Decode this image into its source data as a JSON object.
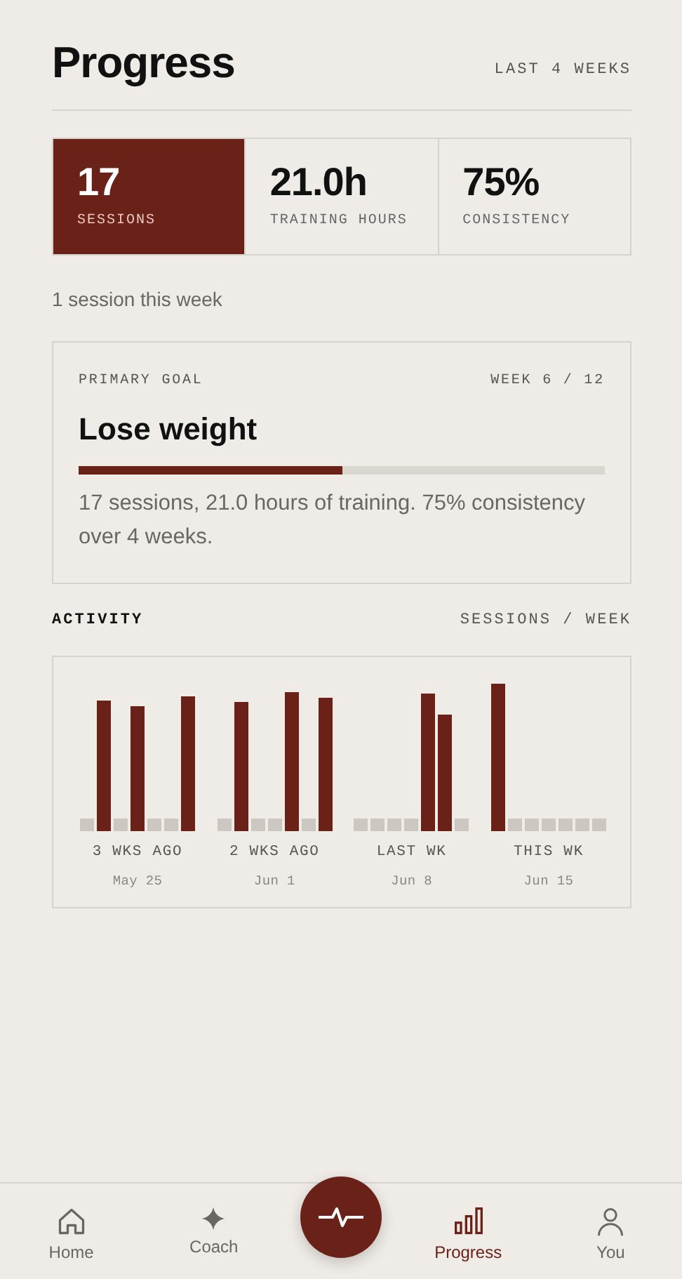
{
  "header": {
    "title": "Progress",
    "range": "LAST 4 WEEKS"
  },
  "stats": [
    {
      "value": "17",
      "label": "SESSIONS",
      "selected": true
    },
    {
      "value": "21.0h",
      "label": "TRAINING HOURS",
      "selected": false
    },
    {
      "value": "75%",
      "label": "CONSISTENCY",
      "selected": false
    }
  ],
  "week_note": "1 session this week",
  "goal": {
    "label": "PRIMARY GOAL",
    "week": "WEEK 6 / 12",
    "title": "Lose weight",
    "level": 0.5,
    "summary": "17 sessions, 21.0 hours of training. 75% consistency over 4 weeks."
  },
  "activity": {
    "title": "ACTIVITY",
    "unit": "SESSIONS / WEEK",
    "weeks": [
      {
        "label": "3 WKS AGO",
        "date": "May 25",
        "days": [
          {
            "trained": false
          },
          {
            "trained": true
          },
          {
            "trained": false
          },
          {
            "trained": true
          },
          {
            "trained": false
          },
          {
            "trained": false
          },
          {
            "trained": true
          }
        ]
      },
      {
        "label": "2 WKS AGO",
        "date": "Jun 1",
        "days": [
          {
            "trained": false
          },
          {
            "trained": true
          },
          {
            "trained": false
          },
          {
            "trained": false
          },
          {
            "trained": true
          },
          {
            "trained": false
          },
          {
            "trained": true
          }
        ]
      },
      {
        "label": "LAST WK",
        "date": "Jun 8",
        "days": [
          {
            "trained": false
          },
          {
            "trained": false
          },
          {
            "trained": false
          },
          {
            "trained": false
          },
          {
            "trained": true
          },
          {
            "trained": true
          },
          {
            "trained": false
          }
        ]
      },
      {
        "label": "THIS WK",
        "date": "Jun 15",
        "days": [
          {
            "trained": true
          },
          {
            "trained": false
          },
          {
            "trained": false
          },
          {
            "trained": false
          },
          {
            "trained": false
          },
          {
            "trained": false
          },
          {
            "trained": false
          }
        ]
      }
    ]
  },
  "nav": [
    {
      "kind": "home",
      "label": "Home",
      "selected": false
    },
    {
      "kind": "coach",
      "label": "Coach",
      "selected": false
    },
    {
      "kind": "pulse"
    },
    {
      "kind": "progress",
      "label": "Progress",
      "selected": true
    },
    {
      "kind": "you",
      "label": "You",
      "selected": false
    }
  ]
}
